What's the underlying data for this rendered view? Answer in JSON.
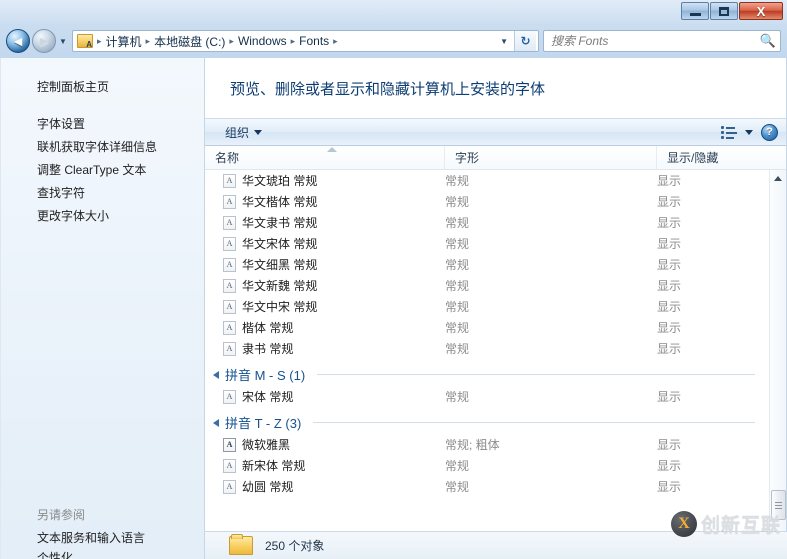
{
  "window": {
    "minimize_label": "—",
    "maximize_label": "□",
    "close_label": "X"
  },
  "nav": {
    "back_glyph": "◄",
    "forward_glyph": "►",
    "history_caret": "▼",
    "address_caret": "▼",
    "refresh_glyph": "↻",
    "breadcrumb": [
      "计算机",
      "本地磁盘 (C:)",
      "Windows",
      "Fonts"
    ],
    "separator": "▸"
  },
  "search": {
    "placeholder": "搜索 Fonts",
    "value": "",
    "icon": "search-icon"
  },
  "sidebar": {
    "home": "控制面板主页",
    "items": [
      "字体设置",
      "联机获取字体详细信息",
      "调整 ClearType 文本",
      "查找字符",
      "更改字体大小"
    ],
    "see_also_heading": "另请参阅",
    "see_also_items": [
      "文本服务和输入语言"
    ],
    "clipped_item": "个性化"
  },
  "main": {
    "page_title": "预览、删除或者显示和隐藏计算机上安装的字体",
    "toolbar": {
      "organize_label": "组织",
      "view_icon": "view-options-icon",
      "help_label": "?"
    },
    "columns": {
      "name": "名称",
      "style": "字形",
      "show_hide": "显示/隐藏"
    },
    "rows": [
      {
        "name": "华文琥珀 常规",
        "style": "常规",
        "show": "显示",
        "icon": "font-file-icon"
      },
      {
        "name": "华文楷体 常规",
        "style": "常规",
        "show": "显示",
        "icon": "font-file-icon"
      },
      {
        "name": "华文隶书 常规",
        "style": "常规",
        "show": "显示",
        "icon": "font-file-icon"
      },
      {
        "name": "华文宋体 常规",
        "style": "常规",
        "show": "显示",
        "icon": "font-file-icon"
      },
      {
        "name": "华文细黑 常规",
        "style": "常规",
        "show": "显示",
        "icon": "font-file-icon"
      },
      {
        "name": "华文新魏 常规",
        "style": "常规",
        "show": "显示",
        "icon": "font-file-icon"
      },
      {
        "name": "华文中宋 常规",
        "style": "常规",
        "show": "显示",
        "icon": "font-file-icon"
      },
      {
        "name": "楷体 常规",
        "style": "常规",
        "show": "显示",
        "icon": "font-file-icon"
      },
      {
        "name": "隶书 常规",
        "style": "常规",
        "show": "显示",
        "icon": "font-file-icon"
      }
    ],
    "groups": [
      {
        "label": "拼音 M - S (1)",
        "rows": [
          {
            "name": "宋体 常规",
            "style": "常规",
            "show": "显示",
            "icon": "font-file-icon"
          }
        ]
      },
      {
        "label": "拼音 T - Z (3)",
        "rows": [
          {
            "name": "微软雅黑",
            "style": "常规; 粗体",
            "show": "显示",
            "icon": "font-file-icon-bold"
          },
          {
            "name": "新宋体 常规",
            "style": "常规",
            "show": "显示",
            "icon": "font-file-icon"
          },
          {
            "name": "幼圆 常规",
            "style": "常规",
            "show": "显示",
            "icon": "font-file-icon"
          }
        ]
      }
    ]
  },
  "status": {
    "object_count": "250 个对象",
    "folder_icon": "folder-icon"
  },
  "watermark": {
    "logo": "X",
    "text": "创新互联"
  },
  "colors": {
    "accent": "#15538f",
    "title_text": "#0c3d73",
    "close_button": "#bc3c22"
  }
}
